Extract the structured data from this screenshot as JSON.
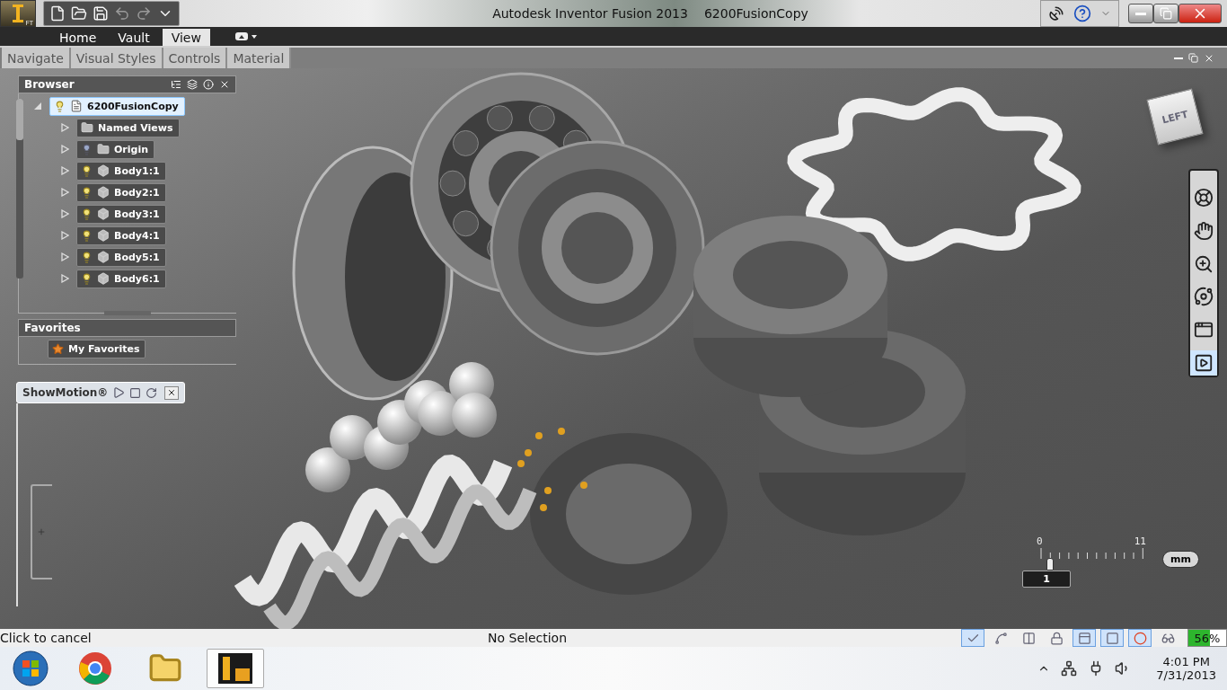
{
  "app_menu": {
    "badge": "FT"
  },
  "quick_access": [
    {
      "kind": "new",
      "disabled": false
    },
    {
      "kind": "open",
      "disabled": false
    },
    {
      "kind": "save",
      "disabled": false
    },
    {
      "kind": "undo",
      "disabled": true
    },
    {
      "kind": "redo",
      "disabled": true
    },
    {
      "kind": "more",
      "disabled": false
    }
  ],
  "title": {
    "app": "Autodesk Inventor Fusion 2013",
    "document": "6200FusionCopy"
  },
  "ribbon_tabs": [
    {
      "label": "Home",
      "selected": false
    },
    {
      "label": "Vault",
      "selected": false
    },
    {
      "label": "View",
      "selected": true
    }
  ],
  "ribbon_panels": [
    "Navigate",
    "Visual Styles",
    "Controls",
    "Material"
  ],
  "browser": {
    "title": "Browser",
    "tree": [
      {
        "label": "6200FusionCopy",
        "kind": "part",
        "selected": true,
        "expanded": true,
        "visible": true,
        "children": [
          {
            "label": "Named Views",
            "kind": "views",
            "selected": false,
            "expanded": false
          },
          {
            "label": "Origin",
            "kind": "folder",
            "selected": false,
            "expanded": false,
            "visible": false
          },
          {
            "label": "Body1:1",
            "kind": "body",
            "selected": false,
            "expanded": false,
            "visible": true
          },
          {
            "label": "Body2:1",
            "kind": "body",
            "selected": false,
            "expanded": false,
            "visible": true
          },
          {
            "label": "Body3:1",
            "kind": "body",
            "selected": false,
            "expanded": false,
            "visible": true
          },
          {
            "label": "Body4:1",
            "kind": "body",
            "selected": false,
            "expanded": false,
            "visible": true
          },
          {
            "label": "Body5:1",
            "kind": "body",
            "selected": false,
            "expanded": false,
            "visible": true
          },
          {
            "label": "Body6:1",
            "kind": "body",
            "selected": false,
            "expanded": false,
            "visible": true
          }
        ]
      }
    ]
  },
  "favorites": {
    "title": "Favorites",
    "items": [
      "My Favorites"
    ]
  },
  "showmotion": {
    "title": "ShowMotion®"
  },
  "viewcube": {
    "face": "LEFT"
  },
  "navigation_bar": [
    {
      "kind": "wheel",
      "selected": false
    },
    {
      "kind": "pan",
      "selected": false
    },
    {
      "kind": "zoom",
      "selected": false
    },
    {
      "kind": "orbit",
      "selected": false
    },
    {
      "kind": "look",
      "selected": false
    },
    {
      "kind": "showmotion",
      "selected": true
    }
  ],
  "scale": {
    "min": "0",
    "max": "11",
    "unit": "mm",
    "value": "1",
    "level": 0.09
  },
  "status_bar": {
    "prompt": "Click to cancel",
    "selection": "No Selection",
    "tools": [
      {
        "kind": "check",
        "selected": true
      },
      {
        "kind": "arch",
        "selected": false
      },
      {
        "kind": "bracket",
        "selected": false
      },
      {
        "kind": "lock",
        "selected": false
      },
      {
        "kind": "frame",
        "selected": true
      },
      {
        "kind": "plane",
        "selected": true
      },
      {
        "kind": "ring",
        "selected": true
      },
      {
        "kind": "glasses",
        "selected": false
      }
    ],
    "battery": {
      "reading": "56%",
      "level": 0.56
    }
  },
  "taskbar": {
    "apps": [
      {
        "kind": "chrome",
        "selected": false
      },
      {
        "kind": "explorer",
        "selected": false
      },
      {
        "kind": "inventor",
        "selected": true
      }
    ],
    "time": "4:01 PM",
    "date": "7/31/2013"
  }
}
